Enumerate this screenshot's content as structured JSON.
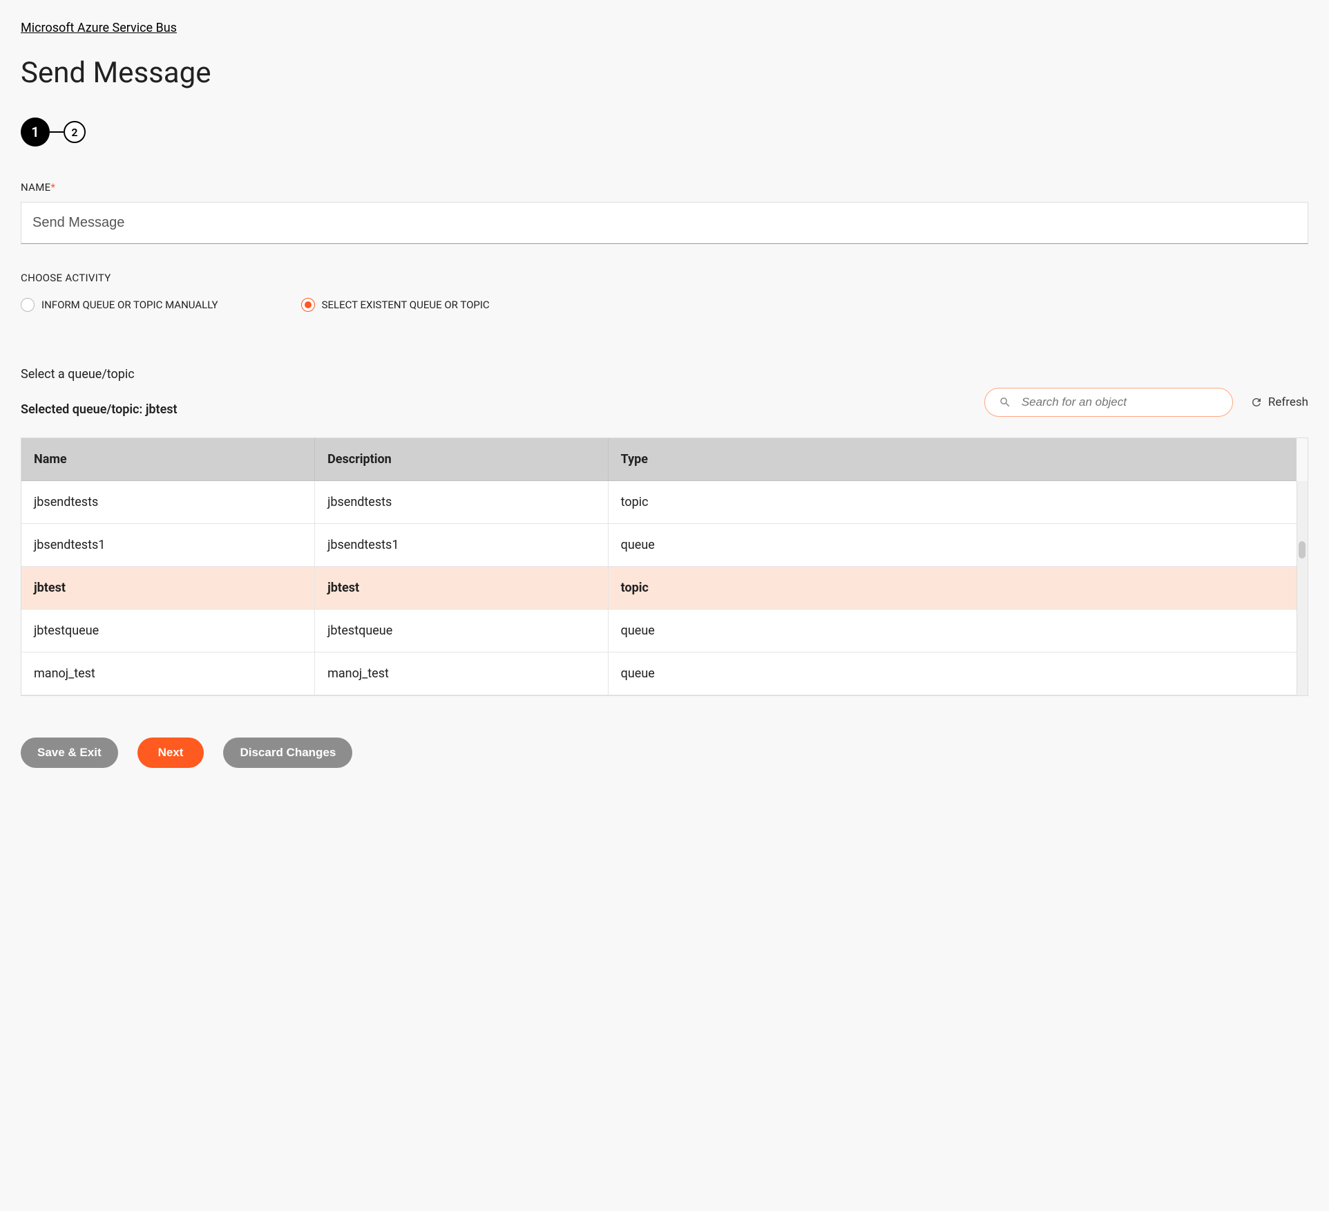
{
  "breadcrumb": "Microsoft Azure Service Bus",
  "title": "Send Message",
  "steps": [
    "1",
    "2"
  ],
  "form": {
    "name_label": "NAME",
    "name_value": "Send Message",
    "activity_label": "CHOOSE ACTIVITY",
    "radio_manual": "INFORM QUEUE OR TOPIC MANUALLY",
    "radio_select": "SELECT EXISTENT QUEUE OR TOPIC"
  },
  "queue": {
    "select_label": "Select a queue/topic",
    "selected_label": "Selected queue/topic: jbtest",
    "search_placeholder": "Search for an object",
    "refresh_label": "Refresh"
  },
  "table": {
    "headers": {
      "name": "Name",
      "description": "Description",
      "type": "Type"
    },
    "rows": [
      {
        "name": "jbsendtests",
        "description": "jbsendtests",
        "type": "topic",
        "selected": false
      },
      {
        "name": "jbsendtests1",
        "description": "jbsendtests1",
        "type": "queue",
        "selected": false
      },
      {
        "name": "jbtest",
        "description": "jbtest",
        "type": "topic",
        "selected": true
      },
      {
        "name": "jbtestqueue",
        "description": "jbtestqueue",
        "type": "queue",
        "selected": false
      },
      {
        "name": "manoj_test",
        "description": "manoj_test",
        "type": "queue",
        "selected": false
      }
    ]
  },
  "buttons": {
    "save_exit": "Save & Exit",
    "next": "Next",
    "discard": "Discard Changes"
  }
}
